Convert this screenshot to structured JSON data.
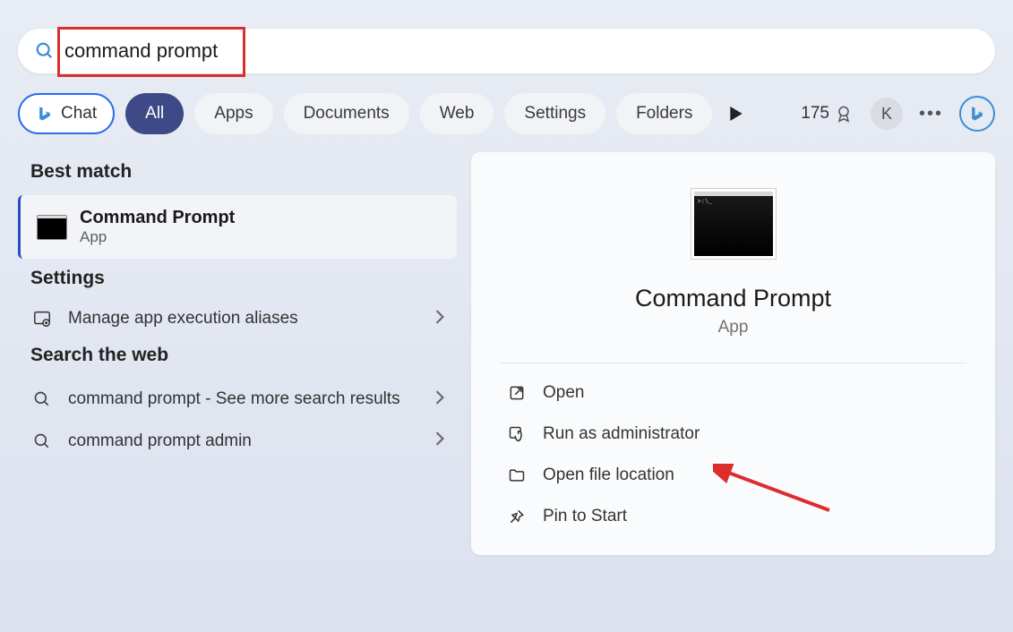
{
  "search": {
    "value": "command prompt"
  },
  "chat_label": "Chat",
  "filter_chips": [
    "All",
    "Apps",
    "Documents",
    "Web",
    "Settings",
    "Folders"
  ],
  "points": "175",
  "avatar_letter": "K",
  "sections": {
    "best_match": "Best match",
    "settings": "Settings",
    "web": "Search the web"
  },
  "best_match_item": {
    "title": "Command Prompt",
    "subtitle": "App"
  },
  "settings_items": [
    {
      "label": "Manage app execution aliases"
    }
  ],
  "web_items": [
    {
      "prefix": "command prompt",
      "suffix": " - See more search results"
    },
    {
      "prefix": "command prompt ",
      "bold": "admin"
    }
  ],
  "preview": {
    "title": "Command Prompt",
    "subtitle": "App",
    "actions": [
      {
        "icon": "open",
        "label": "Open"
      },
      {
        "icon": "admin",
        "label": "Run as administrator"
      },
      {
        "icon": "folder",
        "label": "Open file location"
      },
      {
        "icon": "pin",
        "label": "Pin to Start"
      }
    ]
  }
}
